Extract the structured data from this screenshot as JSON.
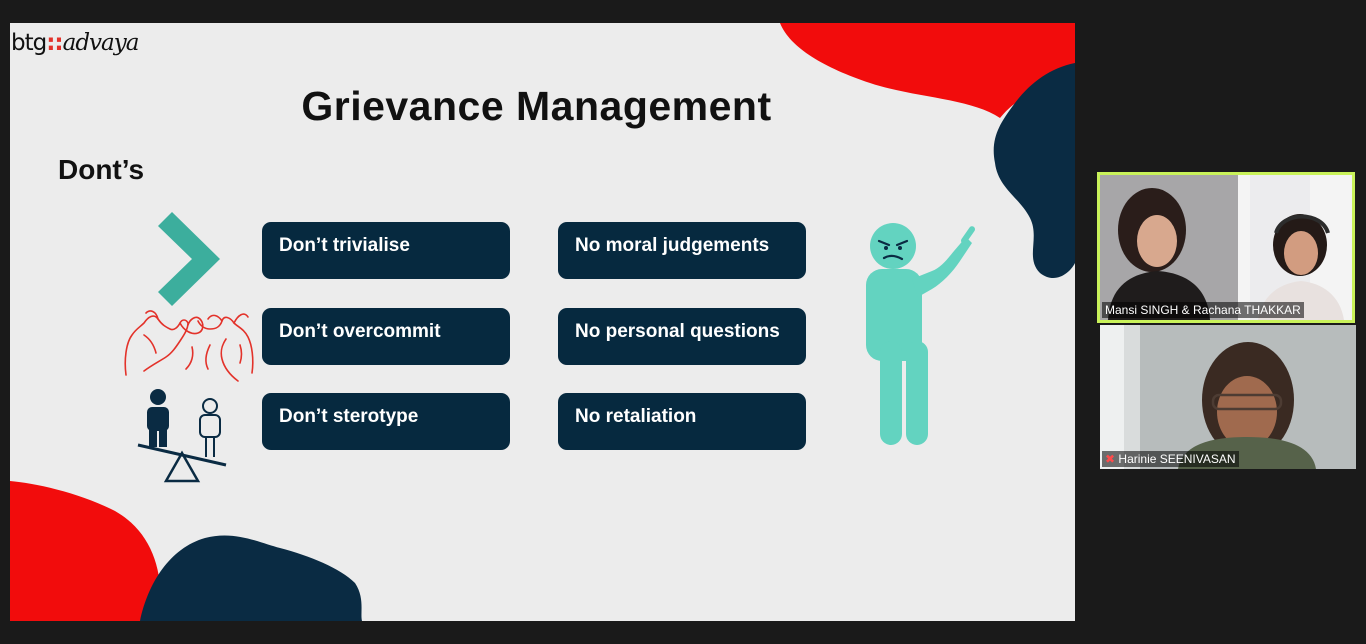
{
  "slide": {
    "logo": {
      "left": "btg",
      "separator": "::",
      "right": "advaya"
    },
    "title": "Grievance Management",
    "subtitle": "Dont’s",
    "cards": {
      "left": [
        "Don’t trivialise",
        "Don’t overcommit",
        "Don’t sterotype"
      ],
      "right": [
        "No moral judgements",
        "No personal questions",
        "No retaliation"
      ]
    },
    "colors": {
      "card": "#06293f",
      "red": "#f20c0c",
      "navy": "#0a2b43",
      "teal": "#3cae9d",
      "figure": "#63d3c0",
      "background": "#ececec"
    },
    "icons": [
      "chevron-right-icon",
      "pinky-promise-icon",
      "seesaw-icon",
      "pointing-figure-icon"
    ]
  },
  "participants": [
    {
      "name": "Mansi SINGH & Rachana THAKKAR",
      "speaking": true
    },
    {
      "name": "Harinie SEENIVASAN",
      "muted": true
    }
  ]
}
